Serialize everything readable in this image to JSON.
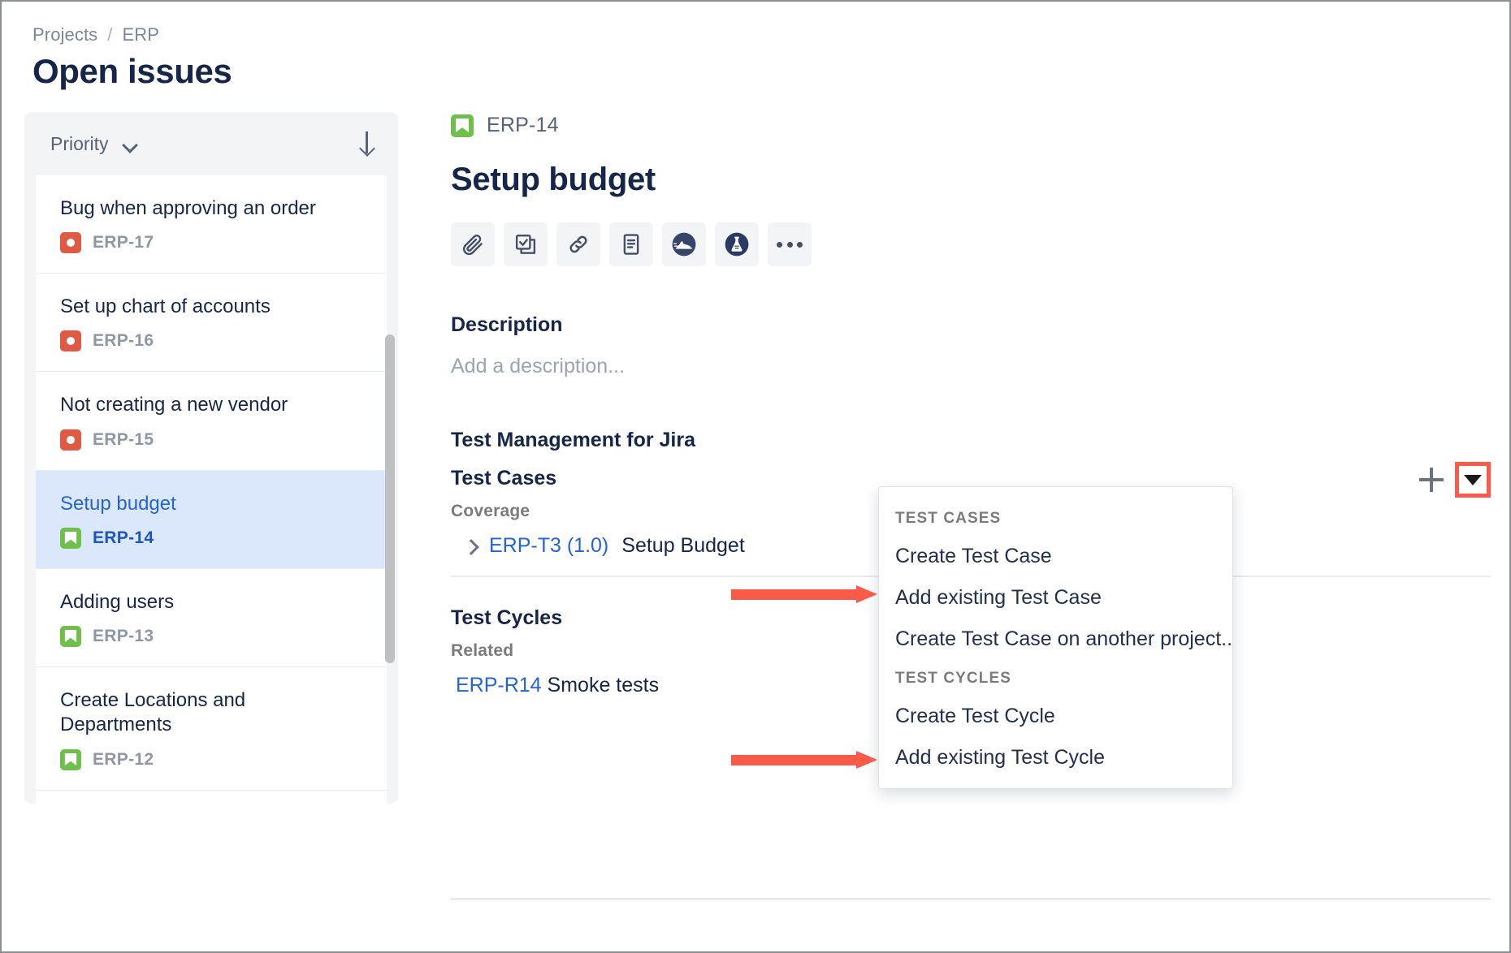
{
  "breadcrumb": {
    "projects": "Projects",
    "separator": "/",
    "project": "ERP"
  },
  "page_title": "Open issues",
  "issue_panel": {
    "sort_label": "Priority",
    "chevron_icon": "chevron-down-icon",
    "sort_direction_icon": "arrow-down-icon",
    "issues": [
      {
        "summary": "Bug when approving an order",
        "key": "ERP-17",
        "type": "bug",
        "selected": false
      },
      {
        "summary": "Set up chart of accounts",
        "key": "ERP-16",
        "type": "bug",
        "selected": false
      },
      {
        "summary": "Not creating a new vendor",
        "key": "ERP-15",
        "type": "bug",
        "selected": false
      },
      {
        "summary": "Setup budget",
        "key": "ERP-14",
        "type": "story",
        "selected": true
      },
      {
        "summary": "Adding users",
        "key": "ERP-13",
        "type": "story",
        "selected": false
      },
      {
        "summary": "Create Locations and Departments",
        "key": "ERP-12",
        "type": "story",
        "selected": false
      }
    ]
  },
  "detail": {
    "issue_key": "ERP-14",
    "issue_type": "story",
    "title": "Setup budget",
    "toolbar": [
      {
        "name": "attach-icon",
        "label": "Attach"
      },
      {
        "name": "subtask-icon",
        "label": "Create subtask"
      },
      {
        "name": "link-icon",
        "label": "Link issue"
      },
      {
        "name": "page-icon",
        "label": "Add page"
      },
      {
        "name": "sneaker-icon",
        "label": "Test cycle"
      },
      {
        "name": "flask-icon",
        "label": "Test case"
      },
      {
        "name": "more-icon",
        "label": "More"
      }
    ],
    "description_heading": "Description",
    "description_placeholder": "Add a description...",
    "tm_section_title": "Test Management for Jira",
    "test_cases": {
      "heading": "Test Cases",
      "sub_label": "Coverage",
      "row_key": "ERP-T3 (1.0)",
      "row_name": "Setup Budget"
    },
    "test_cycles": {
      "heading": "Test Cycles",
      "sub_label": "Related",
      "row_key": "ERP-R14",
      "row_name": "Smoke tests"
    },
    "add_button_label": "+",
    "dropdown_toggle_icon": "caret-down-icon"
  },
  "menu": {
    "groups": [
      {
        "label": "TEST CASES",
        "items": [
          "Create Test Case",
          "Add existing Test Case",
          "Create Test Case on another project..."
        ]
      },
      {
        "label": "TEST CYCLES",
        "items": [
          "Create Test Cycle",
          "Add existing Test Cycle"
        ]
      }
    ]
  },
  "annotations": {
    "highlight_color": "#fc5b4a",
    "arrow_color": "#fa5a48",
    "arrow_targets": [
      "Add existing Test Case",
      "Add existing Test Cycle"
    ]
  },
  "colors": {
    "bug_icon": "#e05a43",
    "story_icon": "#6fc04a",
    "link": "#2563d9",
    "selected_row": "#dbe7fb",
    "text_primary": "#16264a"
  }
}
